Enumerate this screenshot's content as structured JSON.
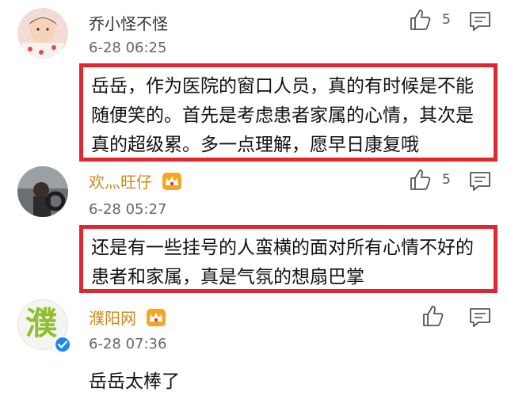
{
  "comments": [
    {
      "username": "乔小怪不怪",
      "time": "6-28 06:25",
      "likes": "5",
      "text": "岳岳，作为医院的窗口人员，真的有时候是不能随便笑的。首先是考虑患者家属的心情，其次是真的超级累。多一点理解，愿早日康复哦",
      "highlighted": true
    },
    {
      "username": "欢灬旺仔",
      "time": "6-28 05:27",
      "likes": "5",
      "text": "还是有一些挂号的人蛮横的面对所有心情不好的患者和家属，真是气氛的想扇巴掌",
      "highlighted": true,
      "badge": "crown-icon"
    },
    {
      "username": "濮阳网",
      "time": "6-28 07:36",
      "likes": "",
      "text": "岳岳太棒了",
      "highlighted": false,
      "badge": "crown-icon",
      "avatar_text": "濮",
      "verified": true
    }
  ],
  "colors": {
    "highlight_border": "#e0262f",
    "vip_name": "#c98a1e",
    "verified": "#1e88e5"
  }
}
